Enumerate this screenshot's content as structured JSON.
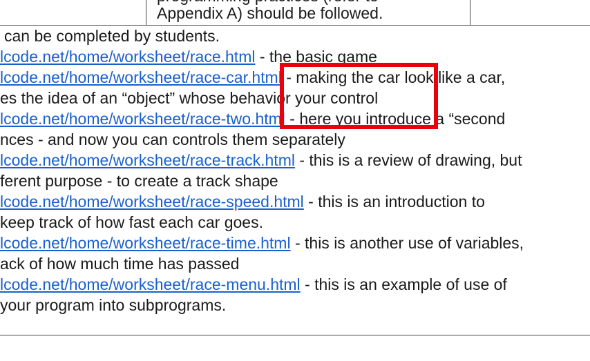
{
  "table_fragment": {
    "cut_text": "programming practices (refer to",
    "full_text": "Appendix A) should be followed."
  },
  "intro": "can be completed by students.",
  "items": [
    {
      "link": "lcode.net/home/worksheet/race.html",
      "desc": " - the basic game",
      "cont": ""
    },
    {
      "link": "lcode.net/home/worksheet/race-car.html",
      "desc": " - making the car look like a car,",
      "cont": "es the idea of an “object” whose behavior your control"
    },
    {
      "link": "lcode.net/home/worksheet/race-two.html",
      "desc": " - here you introduce a “second",
      "cont": "nces - and now you can controls them separately"
    },
    {
      "link": "lcode.net/home/worksheet/race-track.html",
      "desc": " - this is a review of drawing, but",
      "cont": "ferent purpose - to create a track shape"
    },
    {
      "link": "lcode.net/home/worksheet/race-speed.html",
      "desc": " - this is an introduction to",
      "cont": "keep track of how fast each car goes."
    },
    {
      "link": "lcode.net/home/worksheet/race-time.html",
      "desc": " - this is another use of variables,",
      "cont": "ack of how much time has passed"
    },
    {
      "link": "lcode.net/home/worksheet/race-menu.html",
      "desc": " - this is an example of use of",
      "cont": " your program into subprograms."
    }
  ],
  "colors": {
    "link": "#1a5fcf",
    "highlight": "#e8000b"
  }
}
